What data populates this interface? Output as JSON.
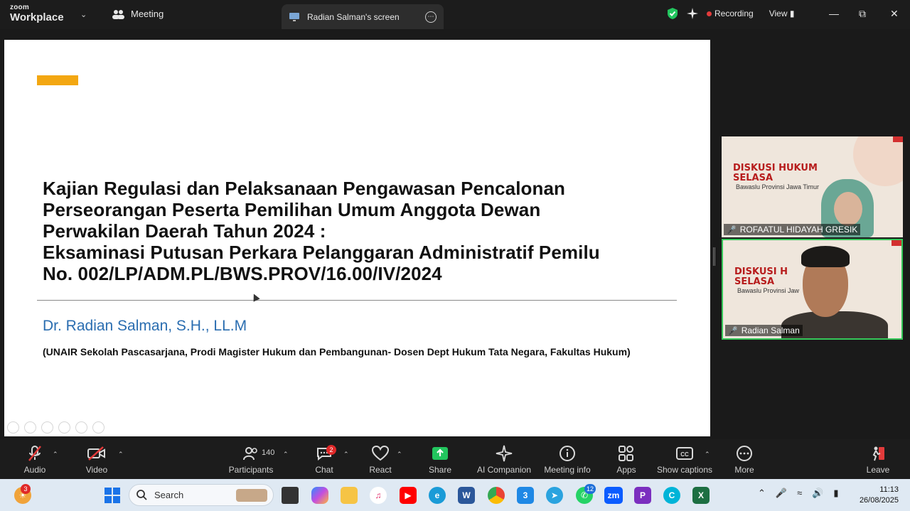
{
  "titlebar": {
    "brand_top": "zoom",
    "brand_bottom": "Workplace",
    "meeting_tab": "Meeting",
    "screen_tab": "Radian Salman's screen",
    "recording": "Recording",
    "view": "View"
  },
  "slide": {
    "title_lines": [
      "Kajian Regulasi dan Pelaksanaan Pengawasan Pencalonan",
      "Perseorangan Peserta Pemilihan Umum Anggota Dewan",
      "Perwakilan Daerah Tahun 2024 :",
      "Eksaminasi Putusan Perkara Pelanggaran Administratif Pemilu",
      "No. 002/LP/ADM.PL/BWS.PROV/16.00/IV/2024"
    ],
    "author": "Dr. Radian Salman, S.H., LL.M",
    "affiliation": "(UNAIR Sekolah Pascasarjana, Prodi Magister Hukum dan Pembangunan- Dosen Dept Hukum Tata Negara, Fakultas Hukum)"
  },
  "participants": [
    {
      "name": "ROFAATUL HIDAYAH GRESIK",
      "banner_line1": "DISKUSI HUKUM",
      "banner_line2": "SELASA",
      "banner_sub": "Bawaslu Provinsi Jawa Timur"
    },
    {
      "name": "Radian Salman",
      "banner_line1": "DISKUSI H",
      "banner_line2": "SELASA",
      "banner_sub": "Bawaslu Provinsi Jaw"
    }
  ],
  "toolbar": {
    "audio": "Audio",
    "video": "Video",
    "participants": "Participants",
    "participants_count": "140",
    "chat": "Chat",
    "chat_badge": "2",
    "react": "React",
    "share": "Share",
    "ai_companion": "AI Companion",
    "meeting_info": "Meeting info",
    "apps": "Apps",
    "show_captions": "Show captions",
    "more": "More",
    "leave": "Leave"
  },
  "taskbar": {
    "search_placeholder": "Search",
    "weather_badge": "3",
    "whatsapp_badge": "12",
    "time": "11:13",
    "date": "26/08/2025"
  },
  "colors": {
    "accent_bar": "#f3a712",
    "author_blue": "#2a6db0",
    "active_speaker": "#35c759",
    "share_green": "#22c55e"
  }
}
